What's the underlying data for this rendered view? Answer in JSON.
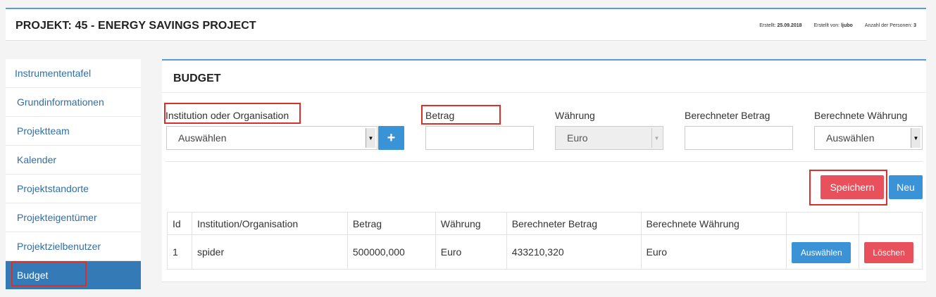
{
  "header": {
    "title": "PROJEKT: 45 - ENERGY SAVINGS PROJECT",
    "created_label": "Erstellt:",
    "created_value": "25.09.2018",
    "created_by_label": "Erstellt von:",
    "created_by_value": "ljubo",
    "persons_label": "Anzahl der Personen:",
    "persons_value": "3"
  },
  "sidebar": {
    "items": [
      {
        "label": "Instrumententafel"
      },
      {
        "label": "Grundinformationen"
      },
      {
        "label": "Projektteam"
      },
      {
        "label": "Kalender"
      },
      {
        "label": "Projektstandorte"
      },
      {
        "label": "Projekteigentümer"
      },
      {
        "label": "Projektzielbenutzer"
      },
      {
        "label": "Budget"
      }
    ],
    "active_index": 7
  },
  "panel": {
    "title": "BUDGET",
    "form": {
      "institution_label": "Institution oder Organisation",
      "institution_value": "Auswählen",
      "add_icon": "plus-icon",
      "betrag_label": "Betrag",
      "betrag_value": "",
      "waehrung_label": "Währung",
      "waehrung_value": "Euro",
      "berechneter_betrag_label": "Berechneter Betrag",
      "berechneter_betrag_value": "",
      "berechnete_waehrung_label": "Berechnete Währung",
      "berechnete_waehrung_value": "Auswählen"
    },
    "buttons": {
      "save": "Speichern",
      "new": "Neu"
    },
    "table": {
      "columns": [
        "Id",
        "Institution/Organisation",
        "Betrag",
        "Währung",
        "Berechneter Betrag",
        "Berechnete Währung",
        "",
        ""
      ],
      "rows": [
        {
          "id": "1",
          "institution": "spider",
          "betrag": "500000,000",
          "waehrung": "Euro",
          "berechneter_betrag": "433210,320",
          "berechnete_waehrung": "Euro",
          "select_label": "Auswählen",
          "delete_label": "Löschen"
        }
      ]
    }
  },
  "colors": {
    "accent_blue": "#3a93d7",
    "active_sidebar": "#337ab7",
    "danger_red": "#e8505b",
    "highlight_red": "#d9302c"
  }
}
